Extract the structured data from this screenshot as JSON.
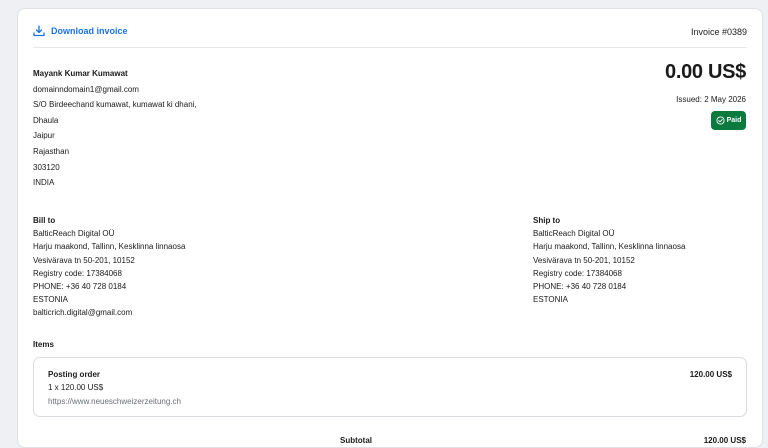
{
  "header": {
    "download_label": "Download invoice",
    "invoice_number": "Invoice #0389"
  },
  "sender": {
    "name": "Mayank Kumar Kumawat",
    "email": "domainndomain1@gmail.com",
    "line1": "S/O Birdeechand kumawat, kumawat ki dhani,",
    "line2": "Dhaula",
    "city": "Jaipur",
    "state": "Rajasthan",
    "zip": "303120",
    "country": "INDIA"
  },
  "summary": {
    "total": "0.00 US$",
    "issued": "Issued: 2 May 2026",
    "status": "Paid"
  },
  "bill_to": {
    "heading": "Bill to",
    "company": "BalticReach Digital OÜ",
    "line1": "Harju maakond, Tallinn, Kesklinna linnaosa",
    "line2": "Vesivärava tn 50-201, 10152",
    "registry": "Registry code: 17384068",
    "phone": "PHONE: +36 40 728 0184",
    "country": "ESTONIA",
    "email": "balticrich.digital@gmail.com"
  },
  "ship_to": {
    "heading": "Ship to",
    "company": "BalticReach Digital OÜ",
    "line1": "Harju maakond, Tallinn, Kesklinna linnaosa",
    "line2": "Vesivärava tn 50-201, 10152",
    "registry": "Registry code: 17384068",
    "phone": "PHONE: +36 40 728 0184",
    "country": "ESTONIA"
  },
  "items": {
    "heading": "Items",
    "list": [
      {
        "title": "Posting order",
        "qty_line": "1 x 120.00 US$",
        "url": "https://www.neueschweizerzeitung.ch",
        "price": "120.00 US$"
      }
    ]
  },
  "totals": {
    "subtotal_label": "Subtotal",
    "subtotal_value": "120.00 US$"
  },
  "colors": {
    "accent": "#1a73e8",
    "paid": "#0b7a3e"
  }
}
